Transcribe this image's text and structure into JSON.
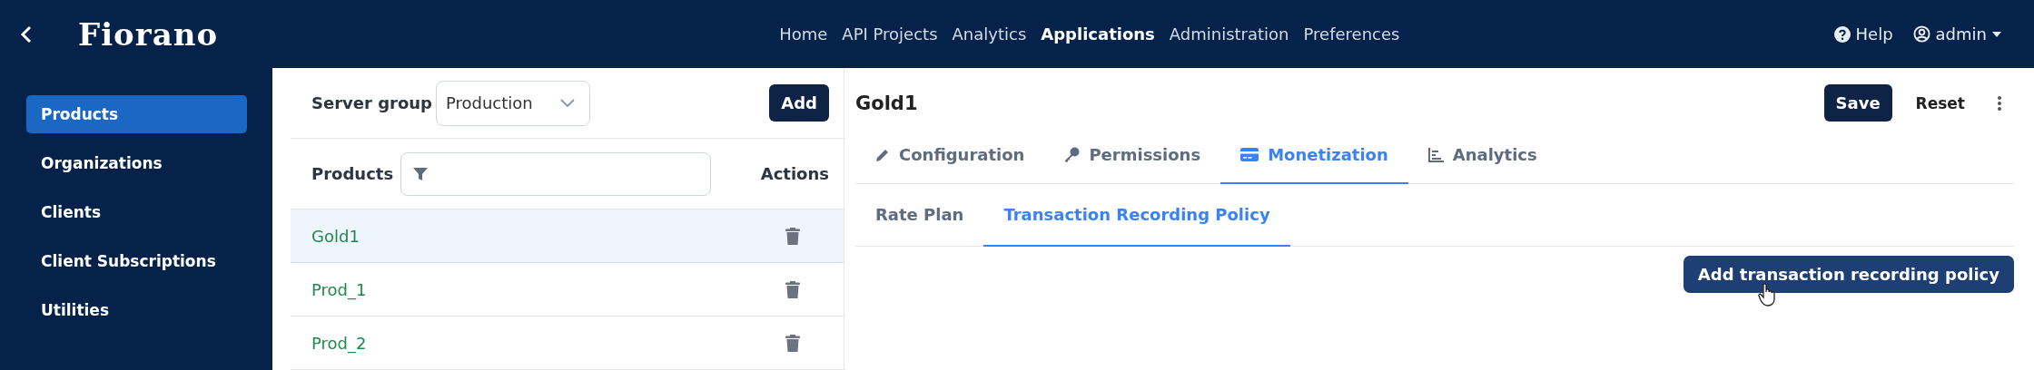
{
  "header": {
    "logo": "Fiorano",
    "nav": [
      {
        "label": "Home",
        "selected": false
      },
      {
        "label": "API Projects",
        "selected": false
      },
      {
        "label": "Analytics",
        "selected": false
      },
      {
        "label": "Applications",
        "selected": true
      },
      {
        "label": "Administration",
        "selected": false
      },
      {
        "label": "Preferences",
        "selected": false
      }
    ],
    "help": "Help",
    "user": "admin"
  },
  "sidebar": {
    "items": [
      {
        "label": "Products",
        "selected": true
      },
      {
        "label": "Organizations",
        "selected": false
      },
      {
        "label": "Clients",
        "selected": false
      },
      {
        "label": "Client Subscriptions",
        "selected": false
      },
      {
        "label": "Utilities",
        "selected": false
      }
    ]
  },
  "products_panel": {
    "server_group_label": "Server group",
    "server_group_value": "Production",
    "add_button": "Add",
    "columns": [
      "Products",
      "Actions"
    ],
    "rows": [
      {
        "name": "Gold1",
        "selected": true
      },
      {
        "name": "Prod_1",
        "selected": false
      },
      {
        "name": "Prod_2",
        "selected": false
      }
    ]
  },
  "detail": {
    "title": "Gold1",
    "save_button": "Save",
    "reset_button": "Reset",
    "tabs": [
      {
        "label": "Configuration",
        "kind": "pencil",
        "selected": false
      },
      {
        "label": "Permissions",
        "kind": "key",
        "selected": false
      },
      {
        "label": "Monetization",
        "kind": "card",
        "selected": true
      },
      {
        "label": "Analytics",
        "kind": "chart",
        "selected": false
      }
    ],
    "subtabs": [
      {
        "label": "Rate Plan",
        "selected": false
      },
      {
        "label": "Transaction Recording Policy",
        "selected": true
      }
    ],
    "action_button": "Add transaction recording policy"
  }
}
